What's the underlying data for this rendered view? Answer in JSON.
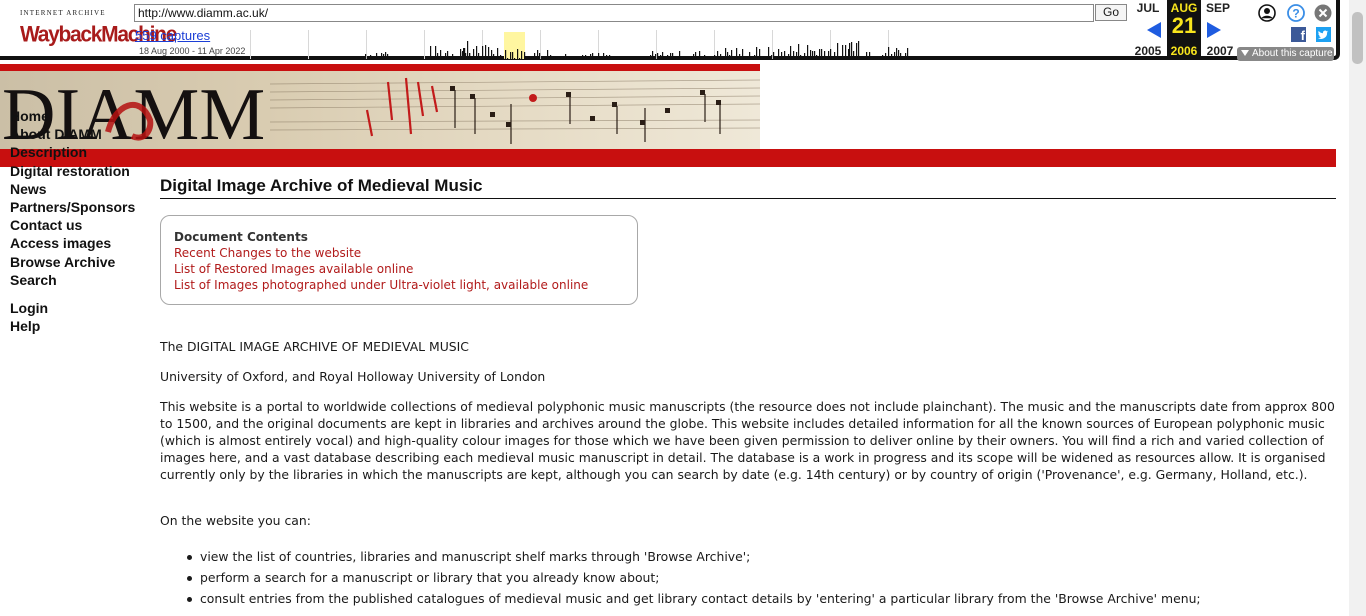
{
  "wayback": {
    "logo_top": "INTERNET ARCHIVE",
    "logo_main": "WaybackMachine",
    "url": "http://www.diamm.ac.uk/",
    "go_label": "Go",
    "captures_label": "559 captures",
    "date_range": "18 Aug 2000 - 11 Apr 2022",
    "months": {
      "prev": "JUL",
      "current": "AUG",
      "next": "SEP"
    },
    "day": "21",
    "years": {
      "prev": "2005",
      "current": "2006",
      "next": "2007"
    },
    "about_label": "About this capture",
    "icons": {
      "account": "account-icon",
      "help": "help-icon",
      "close": "close-icon",
      "facebook": "facebook-icon",
      "twitter": "twitter-icon",
      "prev": "prev-arrow-icon",
      "next": "next-arrow-icon"
    },
    "colors": {
      "accent": "#1f5ce0",
      "highlight": "#f8e51d",
      "toolbar_border": "#111111"
    }
  },
  "site": {
    "logo": "DIAMM",
    "colors": {
      "brand_red": "#c80f0f",
      "link_red": "#b11a1a"
    }
  },
  "nav": [
    "Home",
    "About DIAMM",
    "Description",
    "Digital restoration",
    "News",
    "Partners/Sponsors",
    "Contact us",
    "Access images",
    "Browse Archive",
    "Search",
    "Login",
    "Help"
  ],
  "main": {
    "title": "Digital Image Archive of Medieval Music",
    "toc": {
      "heading": "Document Contents",
      "links": [
        "Recent Changes to the website",
        "List of Restored Images available online",
        "List of Images photographed under Ultra-violet light, available online"
      ]
    },
    "paragraphs": [
      "The DIGITAL IMAGE ARCHIVE OF MEDIEVAL MUSIC",
      "University of Oxford, and Royal Holloway University of London",
      "This website is a portal to worldwide collections of medieval polyphonic music manuscripts (the resource does not include plainchant). The music and the manuscripts date from approx 800 to 1500, and the original documents are kept in libraries and archives around the globe. This website includes detailed information for all the known sources of European polyphonic music (which is almost entirely vocal) and high-quality colour images for those which we have been given permission to deliver online by their owners. You will find a rich and varied collection of images here, and a vast database describing each medieval music manuscript in detail. The database is a work in progress and its scope will be widened as resources allow. It is organised currently only by the libraries in which the manuscripts are kept, although you can search by date (e.g. 14th century) or by country of origin ('Provenance', e.g. Germany, Holland, etc.).",
      "On the website you can:"
    ],
    "bullets": [
      "view the list of countries, libraries and manuscript shelf marks through 'Browse Archive';",
      "perform a search for a manuscript or library that you already know about;",
      "consult entries from the published catalogues of medieval music and get library contact details by 'entering' a particular library from the 'Browse Archive' menu;"
    ]
  }
}
